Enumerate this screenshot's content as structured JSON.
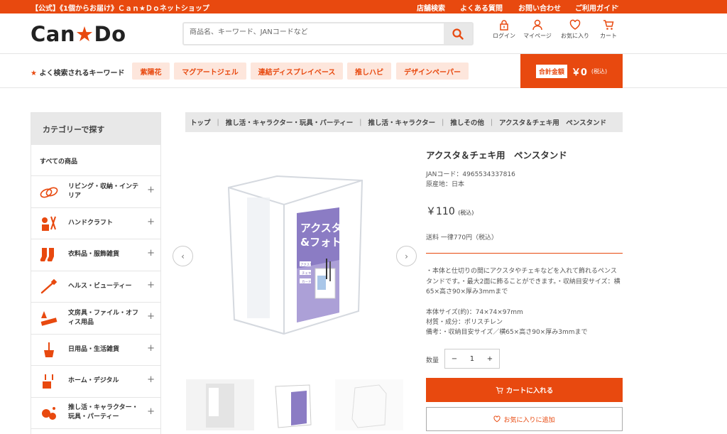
{
  "topbar": {
    "promo": "【公式】《1個からお届け》Ｃａｎ★Ｄｏネットショップ",
    "links": [
      "店舗検索",
      "よくある質問",
      "お問い合わせ",
      "ご利用ガイド"
    ]
  },
  "header": {
    "logo_text_a": "Can",
    "logo_star": "★",
    "logo_text_b": "Do",
    "search_placeholder": "商品名、キーワード、JANコードなど",
    "icons": [
      {
        "label": "ログイン",
        "icon": "lock-icon"
      },
      {
        "label": "マイページ",
        "icon": "user-icon"
      },
      {
        "label": "お気に入り",
        "icon": "heart-icon"
      },
      {
        "label": "カート",
        "icon": "cart-icon"
      }
    ]
  },
  "keywords": {
    "label": "よく検索されるキーワード",
    "items": [
      "紫陽花",
      "マグアートジェル",
      "連結ディスプレイベース",
      "推しハピ",
      "デザインペーパー"
    ]
  },
  "cart_total": {
    "label": "合計金額",
    "amount": "￥0",
    "tax": "(税込)"
  },
  "sidebar": {
    "title": "カテゴリーで探す",
    "all": "すべての商品",
    "categories": [
      {
        "label": "リビング・収納・インテリア",
        "icon": "living-icon"
      },
      {
        "label": "ハンドクラフト",
        "icon": "craft-icon"
      },
      {
        "label": "衣料品・服飾雑貨",
        "icon": "socks-icon"
      },
      {
        "label": "ヘルス・ビューティー",
        "icon": "beauty-icon"
      },
      {
        "label": "文房具・ファイル・オフィス用品",
        "icon": "stationery-icon"
      },
      {
        "label": "日用品・生活雑貨",
        "icon": "broom-icon"
      },
      {
        "label": "ホーム・デジタル",
        "icon": "home-digital-icon"
      },
      {
        "label": "推し活・キャラクター・玩具・パーティー",
        "icon": "party-icon"
      }
    ]
  },
  "breadcrumb": [
    "トップ",
    "推し活・キャラクター・玩具・パーティー",
    "推し活・キャラクター",
    "推しその他",
    "アクスタ＆チェキ用　ペンスタンド"
  ],
  "product": {
    "title": "アクスタ＆チェキ用　ペンスタンド",
    "jan": "JANコード：4965534337816",
    "origin": "原産地：日本",
    "price": "￥110",
    "price_tax": "(税込)",
    "shipping": "送料 一律770円（税込）",
    "desc1": "・本体と仕切りの間にアクスタやチェキなどを入れて飾れるペンスタンドです。・最大2面に飾ることができます。・収納目安サイズ：横65×高さ90×厚み3mmまで",
    "size": "本体サイズ(約)：74×74×97mm",
    "material": "材質・成分：ポリスチレン",
    "note": "備考：・収納目安サイズ／横65×高さ90×厚み3mmまで",
    "qty_label": "数量",
    "qty_minus": "−",
    "qty_value": "1",
    "qty_plus": "+",
    "cart_button": "カートに入れる",
    "fav_button": "お気に入りに追加",
    "package_text_1": "アクスタ",
    "package_text_2": "&フォト",
    "package_tag_1": "アクスタ",
    "package_tag_2": "チェキ",
    "package_tag_3": "カード"
  },
  "colors": {
    "accent": "#e8490f",
    "accent_light": "#fde6dc",
    "package_purple": "#7a6bb5"
  }
}
